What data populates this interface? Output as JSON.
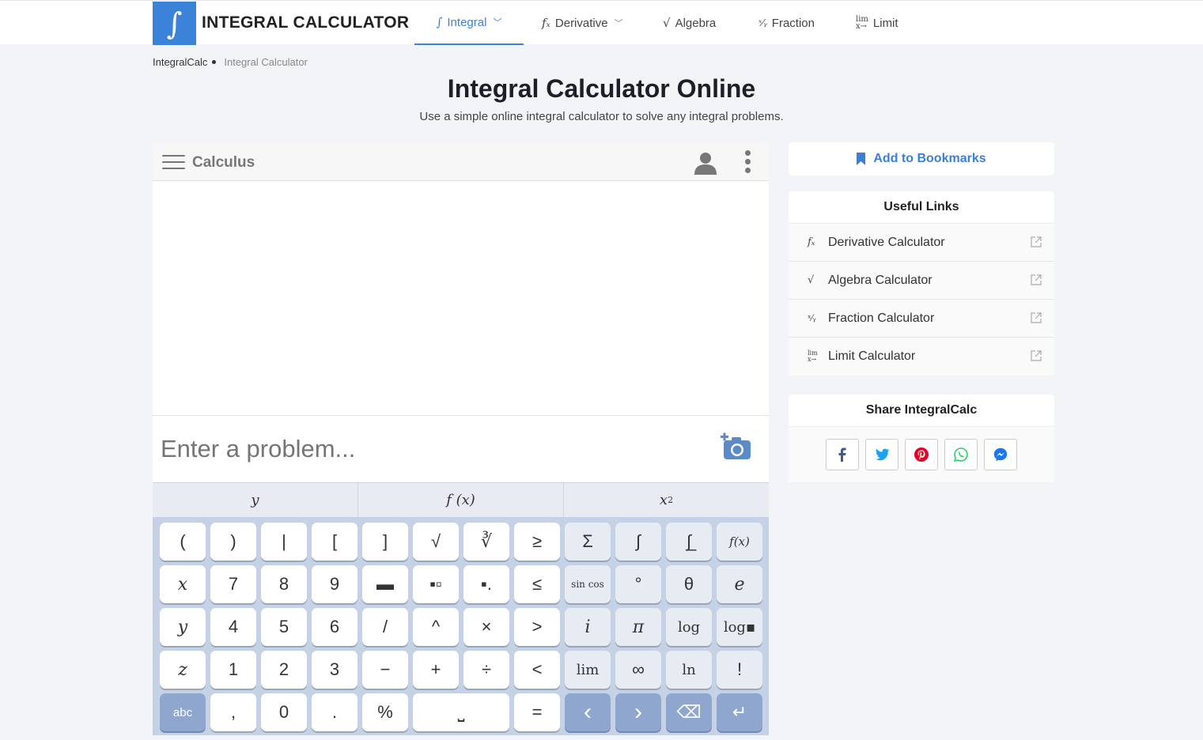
{
  "brand": {
    "logo_glyph": "∫",
    "name": "INTEGRAL CALCULATOR",
    "color": "#3b82d9"
  },
  "nav": [
    {
      "icon": "∫",
      "label": "Integral",
      "active": true,
      "dropdown": true
    },
    {
      "icon": "fx",
      "label": "Derivative",
      "dropdown": true
    },
    {
      "icon": "√",
      "label": "Algebra"
    },
    {
      "icon": "x/y",
      "label": "Fraction"
    },
    {
      "icon": "lim",
      "label": "Limit"
    }
  ],
  "breadcrumb": {
    "home": "IntegralCalc",
    "current": "Integral Calculator"
  },
  "header": {
    "title": "Integral Calculator Online",
    "subtitle": "Use a simple online integral calculator to solve any integral problems."
  },
  "calculator": {
    "title": "Calculus",
    "input_placeholder": "Enter a problem...",
    "tabs": [
      "y",
      "f (x)",
      "x",
      "2"
    ],
    "keys": {
      "r1": [
        "(",
        ")",
        "|",
        "[",
        "]",
        "√",
        "∛",
        "≥",
        "Σ",
        "∫",
        "∫̲",
        "f(x)"
      ],
      "r2": [
        "x",
        "7",
        "8",
        "9",
        "▬",
        "▪▫",
        "▪.",
        "≤",
        "sin cos",
        "°",
        "θ",
        "e"
      ],
      "r3": [
        "y",
        "4",
        "5",
        "6",
        "/",
        "^",
        "×",
        ">",
        "i",
        "π",
        "log",
        "log▪"
      ],
      "r4": [
        "z",
        "1",
        "2",
        "3",
        "−",
        "+",
        "÷",
        "<",
        "lim",
        "∞",
        "ln",
        "!"
      ],
      "r5": [
        "abc",
        ",",
        "0",
        ".",
        "%",
        "⎵",
        "=",
        "‹",
        "›",
        "⌫",
        "↵"
      ]
    }
  },
  "sidebar": {
    "bookmark": "Add to Bookmarks",
    "useful_title": "Useful Links",
    "links": [
      {
        "icon": "fx",
        "label": "Derivative Calculator"
      },
      {
        "icon": "√",
        "label": "Algebra Calculator"
      },
      {
        "icon": "x/y",
        "label": "Fraction Calculator"
      },
      {
        "icon": "lim",
        "label": "Limit Calculator"
      }
    ],
    "share_title": "Share IntegralCalc",
    "share": [
      "facebook-icon",
      "twitter-icon",
      "pinterest-icon",
      "whatsapp-icon",
      "messenger-icon"
    ]
  }
}
